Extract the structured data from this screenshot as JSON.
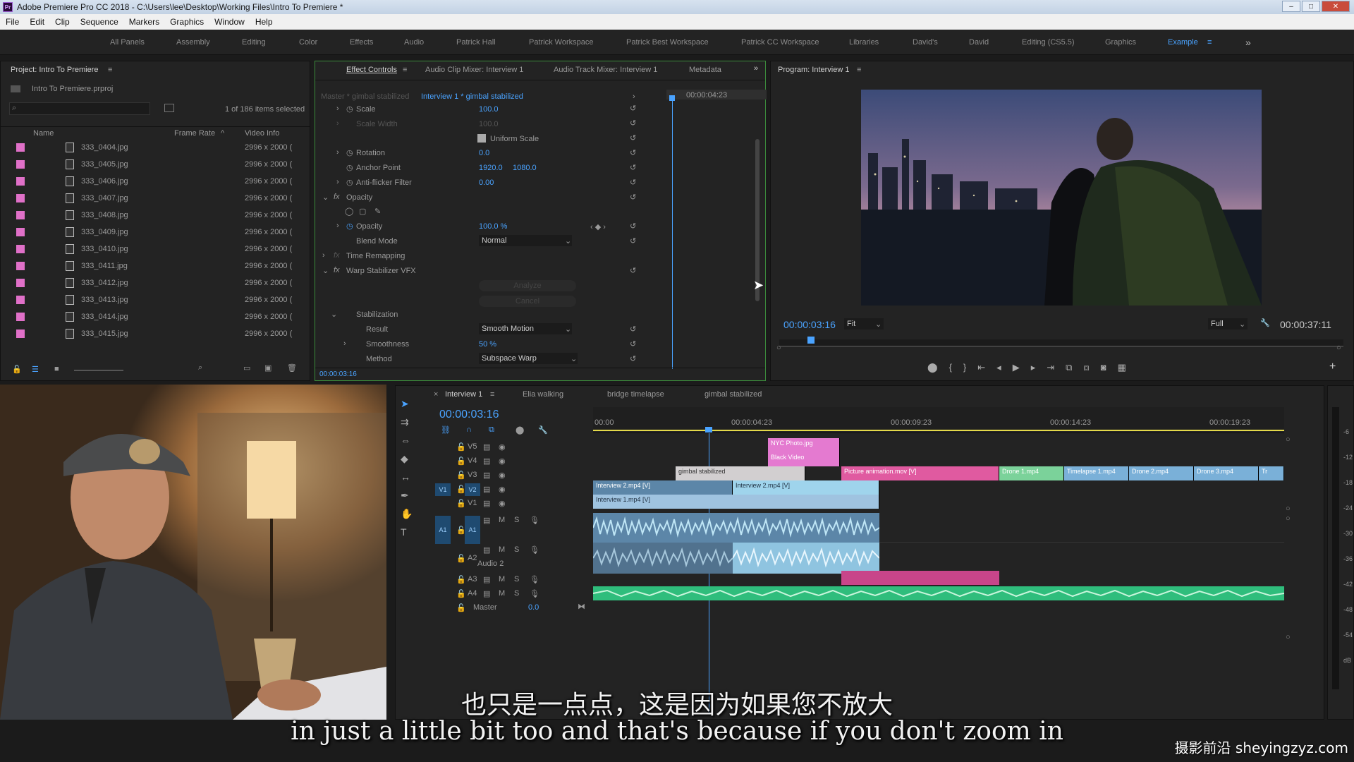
{
  "window": {
    "title": "Adobe Premiere Pro CC 2018 - C:\\Users\\lee\\Desktop\\Working Files\\Intro To Premiere *",
    "app_icon": "Pr"
  },
  "menu": [
    "File",
    "Edit",
    "Clip",
    "Sequence",
    "Markers",
    "Graphics",
    "Window",
    "Help"
  ],
  "workspaces": [
    "All Panels",
    "Assembly",
    "Editing",
    "Color",
    "Effects",
    "Audio",
    "Patrick Hall",
    "Patrick Workspace",
    "Patrick Best Workspace",
    "Patrick CC Workspace",
    "Libraries",
    "David's",
    "David",
    "Editing (CS5.5)",
    "Graphics",
    "Example"
  ],
  "workspace_active": "Example",
  "project": {
    "tab": "Project: Intro To Premiere",
    "file": "Intro To Premiere.prproj",
    "selected": "1 of 186 items selected",
    "columns": {
      "name": "Name",
      "frame_rate": "Frame Rate",
      "video_info": "Video Info"
    },
    "items": [
      {
        "name": "333_0404.jpg",
        "info": "2996 x 2000 ("
      },
      {
        "name": "333_0405.jpg",
        "info": "2996 x 2000 ("
      },
      {
        "name": "333_0406.jpg",
        "info": "2996 x 2000 ("
      },
      {
        "name": "333_0407.jpg",
        "info": "2996 x 2000 ("
      },
      {
        "name": "333_0408.jpg",
        "info": "2996 x 2000 ("
      },
      {
        "name": "333_0409.jpg",
        "info": "2996 x 2000 ("
      },
      {
        "name": "333_0410.jpg",
        "info": "2996 x 2000 ("
      },
      {
        "name": "333_0411.jpg",
        "info": "2996 x 2000 ("
      },
      {
        "name": "333_0412.jpg",
        "info": "2996 x 2000 ("
      },
      {
        "name": "333_0413.jpg",
        "info": "2996 x 2000 ("
      },
      {
        "name": "333_0414.jpg",
        "info": "2996 x 2000 ("
      },
      {
        "name": "333_0415.jpg",
        "info": "2996 x 2000 ("
      }
    ]
  },
  "effect_controls": {
    "tabs": [
      "Effect Controls",
      "Audio Clip Mixer: Interview 1",
      "Audio Track Mixer: Interview 1",
      "Metadata"
    ],
    "master": "Master * gimbal stabilized",
    "clip": "Interview 1 * gimbal stabilized",
    "timecode": "00:00:04:23",
    "current": "00:00:03:16",
    "props": {
      "scale": "Scale",
      "scale_v": "100.0",
      "scale_width": "Scale Width",
      "scale_width_v": "100.0",
      "uniform": "Uniform Scale",
      "rotation": "Rotation",
      "rotation_v": "0.0",
      "anchor": "Anchor Point",
      "anchor_x": "1920.0",
      "anchor_y": "1080.0",
      "flicker": "Anti-flicker Filter",
      "flicker_v": "0.00",
      "opacity_group": "Opacity",
      "opacity": "Opacity",
      "opacity_v": "100.0 %",
      "blend": "Blend Mode",
      "blend_v": "Normal",
      "time_remap": "Time Remapping",
      "warp": "Warp Stabilizer VFX",
      "analyze": "Analyze",
      "cancel": "Cancel",
      "stabilization": "Stabilization",
      "result": "Result",
      "result_v": "Smooth Motion",
      "smoothness": "Smoothness",
      "smoothness_v": "50 %",
      "method": "Method",
      "method_v": "Subspace Warp"
    }
  },
  "program": {
    "tab": "Program: Interview 1",
    "timecode": "00:00:03:16",
    "fit": "Fit",
    "quality": "Full",
    "duration": "00:00:37:11"
  },
  "timeline": {
    "tabs": [
      "Interview 1",
      "Elia walking",
      "bridge timelapse",
      "gimbal stabilized"
    ],
    "timecode": "00:00:03:16",
    "ruler": [
      "00:00",
      "00:00:04:23",
      "00:00:09:23",
      "00:00:14:23",
      "00:00:19:23"
    ],
    "video_tracks": [
      "V5",
      "V4",
      "V3",
      "V2",
      "V1"
    ],
    "audio_tracks": [
      "A1",
      "A2",
      "A3",
      "A4"
    ],
    "audio2_name": "Audio 2",
    "master": "Master",
    "master_v": "0.0",
    "source_v": "V1",
    "source_a": "A1",
    "clips": {
      "nyc": "NYC Photo.jpg",
      "black": "Black Video",
      "gimbal": "gimbal stabilized",
      "picture": "Picture animation.mov [V]",
      "drone1": "Drone 1.mp4",
      "timelapse": "Timelapse 1.mp4",
      "drone2": "Drone 2.mp4",
      "drone3": "Drone 3.mp4",
      "tr": "Tr",
      "int2a": "Interview 2.mp4 [V]",
      "int2b": "Interview 2.mp4 [V]",
      "int1": "Interview 1.mp4 [V]"
    }
  },
  "meter": {
    "ticks": [
      "-6",
      "-12",
      "-18",
      "-24",
      "-30",
      "-36",
      "-42",
      "-48",
      "-54",
      "dB"
    ]
  },
  "subtitles": {
    "cn": "也只是一点点，这是因为如果您不放大",
    "en": "in just a little bit too and that's because if you don't zoom in"
  },
  "watermark": "摄影前沿 sheyingzyz.com",
  "colors": {
    "accent": "#4aa3ff",
    "pink_clip": "#e070c8",
    "audio_blue": "#7ec6e6",
    "green_audio": "#2fbd7c"
  }
}
